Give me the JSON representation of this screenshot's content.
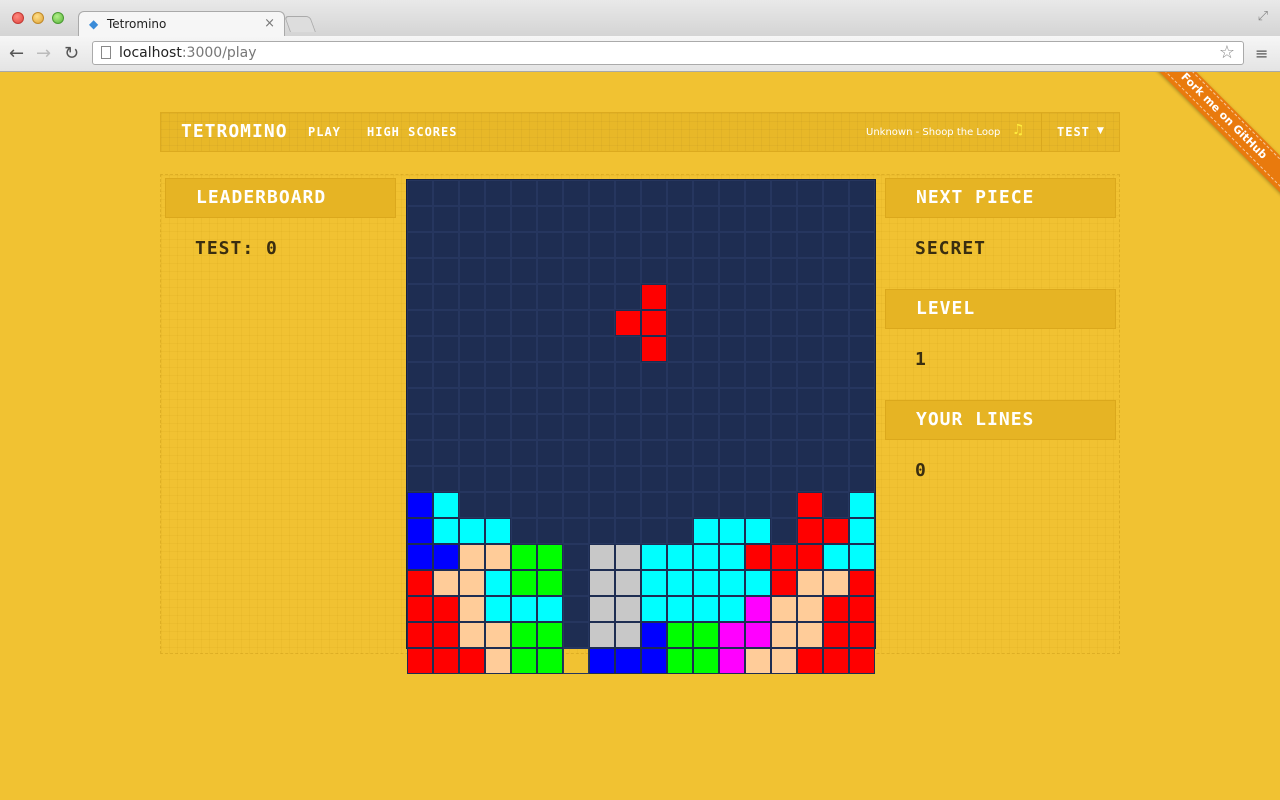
{
  "browser": {
    "tab_title": "Tetromino",
    "tab_close": "×",
    "url_host": "localhost",
    "url_path": ":3000/play",
    "icons": {
      "back": "←",
      "forward": "→",
      "reload": "↻",
      "star": "☆",
      "menu": "≡",
      "resize": "⤢",
      "tab": "◆"
    }
  },
  "nav": {
    "brand": "TETROMINO",
    "play": "PLAY",
    "high_scores": "HIGH SCORES",
    "track": "Unknown - Shoop the Loop",
    "music_icon": "♫",
    "user": "TEST",
    "caret": "▼"
  },
  "ribbon": "Fork me on GitHub",
  "leaderboard": {
    "title": "LEADERBOARD",
    "entries": [
      "TEST: 0"
    ]
  },
  "sidebar": {
    "next_piece_title": "NEXT PIECE",
    "next_piece_value": "SECRET",
    "level_title": "LEVEL",
    "level_value": "1",
    "lines_title": "YOUR LINES",
    "lines_value": "0"
  },
  "colors": {
    "background": "#f1c232",
    "board": "#1e2d52",
    "R": "#ff0000",
    "B": "#0000ff",
    "C": "#00ffff",
    "P": "#ffcc99",
    "G": "#00ff00",
    "S": "#c8c8c8",
    "M": "#ff00ff"
  },
  "board": {
    "columns": 18,
    "rows": [
      "..................",
      "..................",
      "..................",
      "..................",
      ".........R........",
      "........RR........",
      ".........R........",
      "..................",
      "..................",
      "..................",
      "..................",
      "..................",
      "BC.............R.C",
      "BCCC.......CCC.RRC",
      "BBPPGG.SSCCCCRRRCC",
      "RPPCGG.SSCCCCCRPPR",
      "RRPCCC.SSCCCCMPPRR",
      "RRPPGG.SSBGGMMPPRR",
      "RRRPGG.BBBGGMPPRRR"
    ]
  }
}
